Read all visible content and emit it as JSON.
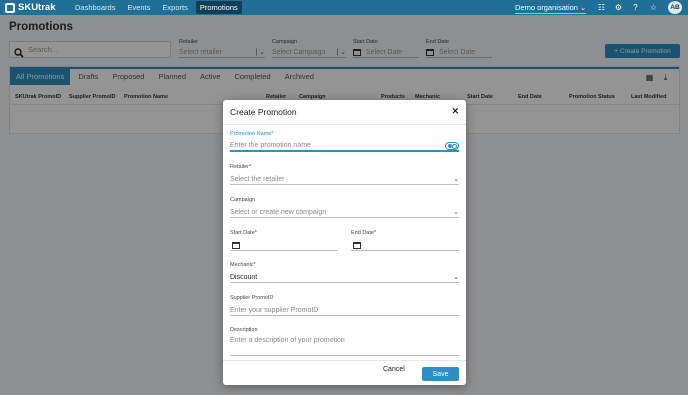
{
  "nav": {
    "logo_text": "SKUtrak",
    "links": [
      "Dashboards",
      "Events",
      "Exports",
      "Promotions"
    ],
    "org": "Demo organisation",
    "avatar": "AB"
  },
  "page": {
    "title": "Promotions",
    "search_placeholder": "Search...",
    "filters": {
      "retailer_label": "Retailer",
      "retailer_placeholder": "Select retailer",
      "campaign_label": "Campaign",
      "campaign_placeholder": "Select Campaign",
      "start_label": "Start Date",
      "start_placeholder": "Select Date",
      "end_label": "End Date",
      "end_placeholder": "Select Date"
    },
    "create_button": "+ Create Promotion"
  },
  "tabs": [
    "All Promotions",
    "Drafts",
    "Proposed",
    "Planned",
    "Active",
    "Completed",
    "Archived"
  ],
  "table": {
    "columns": [
      "SKUtrak PromoID",
      "Supplier PromoID",
      "Promotion Name",
      "Retailer",
      "Campaign",
      "Products",
      "Mechanic",
      "Start Date",
      "End Date",
      "Promotion Status",
      "Last Modified"
    ]
  },
  "modal": {
    "title": "Create Promotion",
    "fields": {
      "name_label": "Promotion Name*",
      "name_placeholder": "Enter the promotion name",
      "retailer_label": "Retailer*",
      "retailer_placeholder": "Select the retailer",
      "campaign_label": "Campaign",
      "campaign_placeholder": "Select or create new campaign",
      "start_label": "Start Date*",
      "end_label": "End Date*",
      "mechanic_label": "Mechanic*",
      "mechanic_value": "Discount",
      "supplier_label": "Supplier PromoID",
      "supplier_placeholder": "Enter your supplier PromoID",
      "description_label": "Description",
      "description_placeholder": "Enter a description of your promotion"
    },
    "cancel": "Cancel",
    "save": "Save"
  },
  "colors": {
    "nav": "#1f6f96",
    "accent": "#2d8fc4"
  }
}
